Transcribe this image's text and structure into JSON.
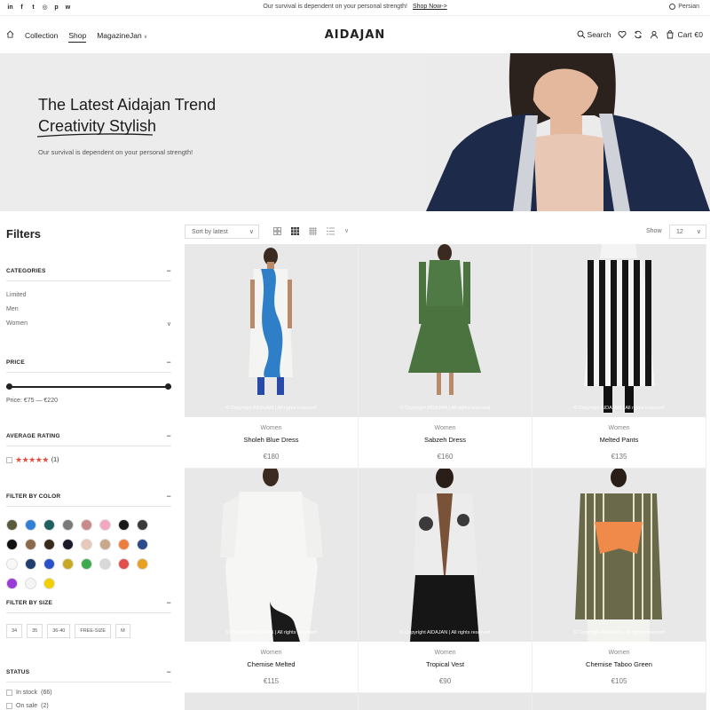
{
  "topbar": {
    "social_icons": [
      "linkedin-icon",
      "facebook-icon",
      "telegram-icon",
      "instagram-icon",
      "pinterest-icon",
      "whatsapp-icon"
    ],
    "social_glyphs": [
      "in",
      "f",
      "t",
      "◎",
      "p",
      "w"
    ],
    "promo_text": "Our survival is dependent on your personal strength!",
    "promo_link": "Shop Now->",
    "language": "Persian"
  },
  "header": {
    "nav": [
      {
        "label": "Collection"
      },
      {
        "label": "Shop"
      },
      {
        "label": "MagazineJan"
      }
    ],
    "logo": "AIDAJAN",
    "search_label": "Search",
    "cart_label": "Cart",
    "cart_total": "€0"
  },
  "hero": {
    "title": "The Latest Aidajan Trend",
    "subtitle": "Creativity Stylish",
    "text": "Our survival is dependent on your personal strength!"
  },
  "sidebar": {
    "title": "Filters",
    "categories": {
      "heading": "CATEGORIES",
      "items": [
        {
          "label": "Limited"
        },
        {
          "label": "Men"
        },
        {
          "label": "Women"
        }
      ]
    },
    "price": {
      "heading": "PRICE",
      "text": "Price: €75 — €220"
    },
    "rating": {
      "heading": "AVERAGE RATING",
      "stars": "★★★★★",
      "count": "(1)"
    },
    "color": {
      "heading": "FILTER BY COLOR",
      "swatches": [
        "#5a5a3e",
        "#2f7fd6",
        "#1f5f5f",
        "#7a7a7a",
        "#c98a8a",
        "#f3a7c0",
        "#1a1a1a",
        "#3a3a3a",
        "#111111",
        "#8a6a4a",
        "#3a2a1a",
        "#1a1a2a",
        "#e8c8b8",
        "#c8a888",
        "#ef7d3c",
        "#2a4a8a",
        "#f8f8f8",
        "#1e3e6e",
        "#2a52c8",
        "#c8a820",
        "#3daa4d",
        "#d8d8d8",
        "#e24d4d",
        "#e8a020",
        "#9a3ad8",
        "#f4f4f4",
        "#f2d000"
      ]
    },
    "size": {
      "heading": "FILTER BY SIZE",
      "items": [
        "34",
        "35",
        "36-40",
        "FREE-SIZE",
        "M"
      ]
    },
    "status": {
      "heading": "STATUS",
      "items": [
        {
          "label": "In stock",
          "count": "(66)"
        },
        {
          "label": "On sale",
          "count": "(2)"
        }
      ]
    }
  },
  "toolbar": {
    "sort_label": "Sort by latest",
    "show_label": "Show",
    "show_value": "12"
  },
  "products": [
    {
      "category": "Women",
      "name": "Sholeh Blue Dress",
      "price": "€180",
      "copyright": "© Copyright AIDAJAN | All rights reserved"
    },
    {
      "category": "Women",
      "name": "Sabzeh Dress",
      "price": "€160",
      "copyright": "© Copyright AIDAJAN | All rights reserved"
    },
    {
      "category": "Women",
      "name": "Melted Pants",
      "price": "€135",
      "copyright": "© Copyright AIDAJAN | All rights reserved"
    },
    {
      "category": "Women",
      "name": "Chemise Melted",
      "price": "€115",
      "copyright": "© Copyright AIDAJAN | All rights reserved"
    },
    {
      "category": "Women",
      "name": "Tropical Vest",
      "price": "€90",
      "copyright": "© Copyright AIDAJAN | All rights reserved"
    },
    {
      "category": "Women",
      "name": "Chemise Taboo Green",
      "price": "€105",
      "copyright": "© Copyright AIDAJAN | All rights reserved"
    }
  ]
}
